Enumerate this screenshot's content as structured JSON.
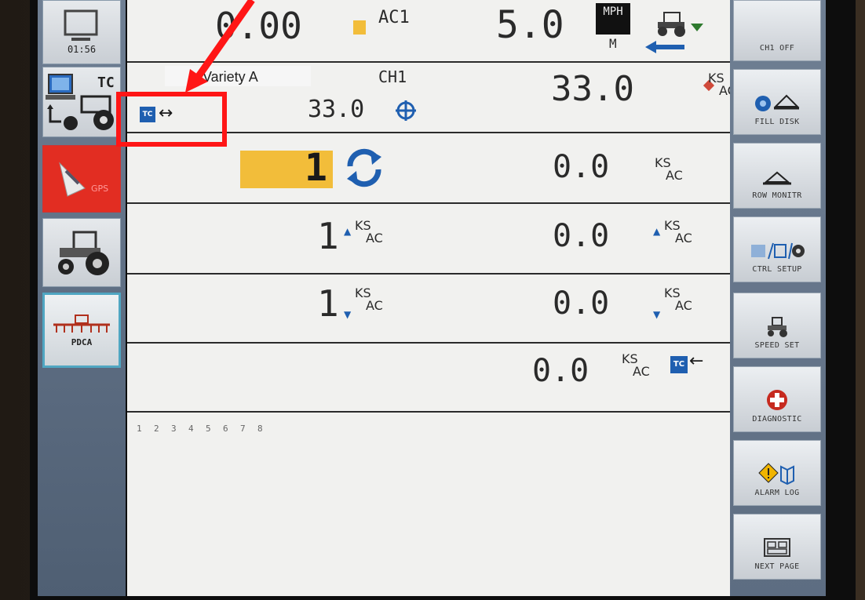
{
  "left_sidebar": {
    "clock": "01:56",
    "tc_label": "TC",
    "gps_label": "GPS",
    "pdca_label": "PDCA"
  },
  "header_row": {
    "app_rate": "0.00",
    "product": "AC1",
    "speed": "5.0",
    "speed_unit": "MPH",
    "speed_sub": "M"
  },
  "channel_row": {
    "variety": "Variety A",
    "channel": "CH1",
    "target_rate": "33.0",
    "actual_rate": "33.0",
    "unit_top": "KS",
    "unit_bot": "AC"
  },
  "rate_select_row": {
    "rate_number": "1",
    "value": "0.0",
    "unit_top": "KS",
    "unit_bot": "AC"
  },
  "increase_row": {
    "step": "1",
    "value": "0.0",
    "unit_top": "KS",
    "unit_bot": "AC"
  },
  "decrease_row": {
    "step": "1",
    "value": "0.0",
    "unit_top": "KS",
    "unit_bot": "AC"
  },
  "tc_rate_row": {
    "value": "0.0",
    "unit_top": "KS",
    "unit_bot": "AC"
  },
  "row_numbers": [
    "1",
    "2",
    "3",
    "4",
    "5",
    "6",
    "7",
    "8"
  ],
  "right_sidebar": {
    "ch1_label": "CH1 OFF",
    "fill_disk": "FILL DISK",
    "row_monitor": "ROW MONITR",
    "ctrl_setup": "CTRL SETUP",
    "speed_set": "SPEED SET",
    "diagnostic": "DIAGNOSTIC",
    "alarm_log": "ALARM LOG",
    "next_page": "NEXT PAGE"
  },
  "colors": {
    "annotation": "#ff1616",
    "accent_blue": "#1f5fb0",
    "highlight_yellow": "#f2bd3a",
    "gps_red": "#e22d22"
  }
}
